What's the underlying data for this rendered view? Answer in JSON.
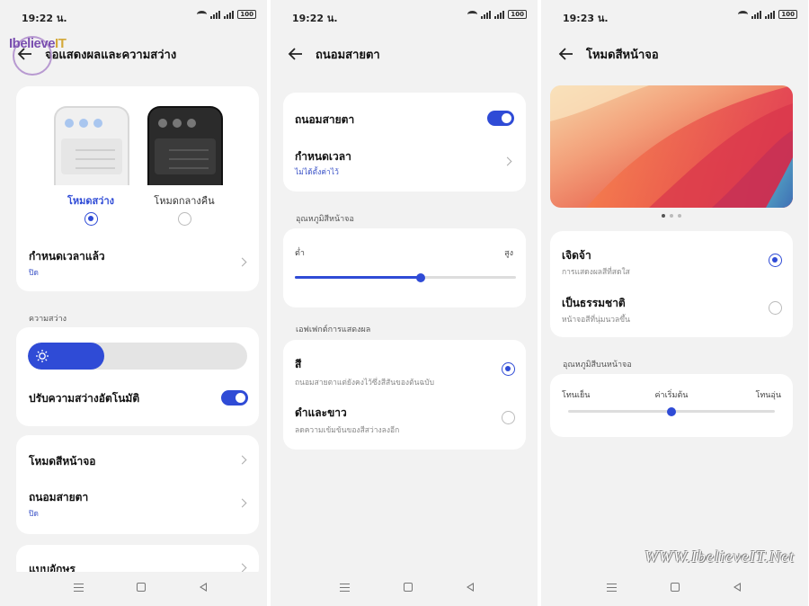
{
  "screen1": {
    "time": "19:22 น.",
    "battery": "100",
    "title": "จอแสดงผลและความสว่าง",
    "mode_light_label": "โหมดสว่าง",
    "mode_dark_label": "โหมดกลางคืน",
    "schedule_title": "กำหนดเวลาแล้ว",
    "schedule_value": "ปิด",
    "brightness_section": "ความสว่าง",
    "brightness_level": 0.35,
    "auto_brightness_label": "ปรับความสว่างอัตโนมัติ",
    "screen_color_mode": "โหมดสีหน้าจอ",
    "eye_comfort_title": "ถนอมสายตา",
    "eye_comfort_value": "ปิด",
    "next_item_partial": "แบบอักษร"
  },
  "screen2": {
    "time": "19:22 น.",
    "battery": "100",
    "title": "ถนอมสายตา",
    "eye_comfort_toggle": "ถนอมสายตา",
    "schedule_title": "กำหนดเวลา",
    "schedule_value": "ไม่ได้ตั้งค่าไว้",
    "temp_section": "อุณหภูมิสีหน้าจอ",
    "low_label": "ต่ำ",
    "high_label": "สูง",
    "temp_level": 0.57,
    "effect_section": "เอฟเฟกต์การแสดงผล",
    "color_title": "สี",
    "color_desc": "ถนอมสายตาแต่ยังคงไว้ซึ่งสีสันของต้นฉบับ",
    "bw_title": "ดำและขาว",
    "bw_desc": "ลดความเข้มข้นของสีสว่างลงอีก"
  },
  "screen3": {
    "time": "19:23 น.",
    "battery": "100",
    "title": "โหมดสีหน้าจอ",
    "vivid_title": "เจิดจ้า",
    "vivid_desc": "การแสดงผลสีที่สดใส",
    "natural_title": "เป็นธรรมชาติ",
    "natural_desc": "หน้าจอสีที่นุ่มนวลขึ้น",
    "temp_section": "อุณหภูมิสีบนหน้าจอ",
    "cool_label": "โทนเย็น",
    "default_label": "ค่าเริ่มต้น",
    "warm_label": "โทนอุ่น",
    "temp_level": 0.5
  },
  "branding": {
    "logo_text": "IbelieveIT",
    "watermark": "WWW.IbelieveIT.Net"
  },
  "colors": {
    "accent": "#2f4bd6",
    "background": "#f2f2f2",
    "card": "#ffffff"
  }
}
